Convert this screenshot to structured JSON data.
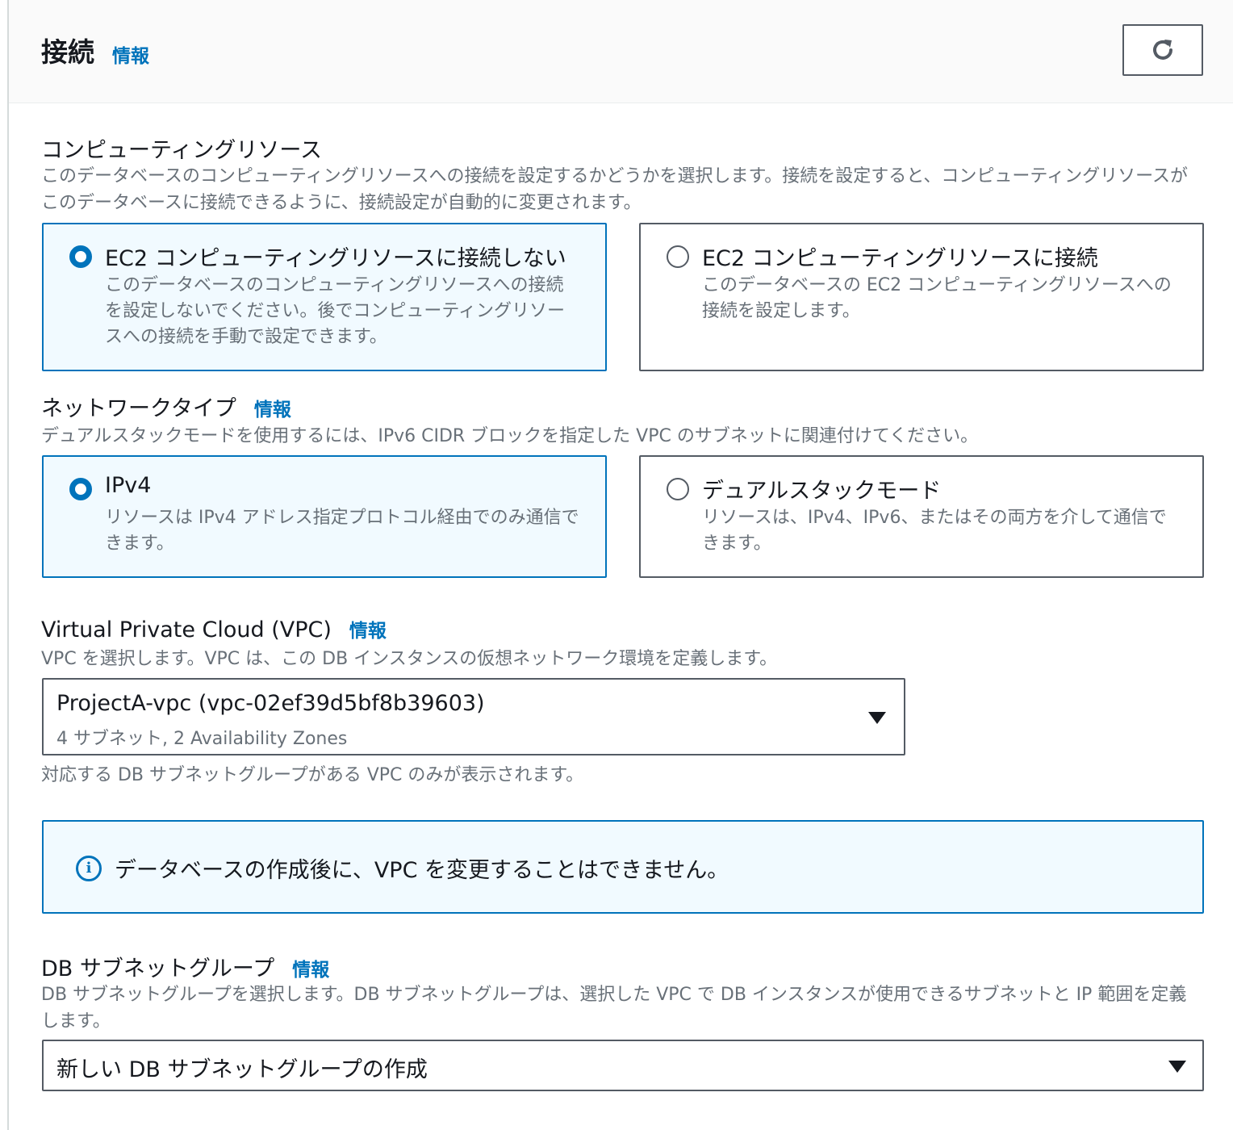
{
  "header": {
    "title": "接続",
    "info": "情報",
    "refresh_icon": "refresh-icon"
  },
  "compute": {
    "label": "コンピューティングリソース",
    "description": "このデータベースのコンピューティングリソースへの接続を設定するかどうかを選択します。接続を設定すると、コンピューティングリソースがこのデータベースに接続できるように、接続設定が自動的に変更されます。",
    "options": [
      {
        "title": "EC2 コンピューティングリソースに接続しない",
        "description": "このデータベースのコンピューティングリソースへの接続を設定しないでください。後でコンピューティングリソースへの接続を手動で設定できます。",
        "selected": true
      },
      {
        "title": "EC2 コンピューティングリソースに接続",
        "description": "このデータベースの EC2 コンピューティングリソースへの接続を設定します。",
        "selected": false
      }
    ]
  },
  "network": {
    "label": "ネットワークタイプ",
    "info": "情報",
    "description": "デュアルスタックモードを使用するには、IPv6 CIDR ブロックを指定した VPC のサブネットに関連付けてください。",
    "options": [
      {
        "title": "IPv4",
        "description": "リソースは IPv4 アドレス指定プロトコル経由でのみ通信できます。",
        "selected": true
      },
      {
        "title": "デュアルスタックモード",
        "description": "リソースは、IPv4、IPv6、またはその両方を介して通信できます。",
        "selected": false
      }
    ]
  },
  "vpc": {
    "label": "Virtual Private Cloud (VPC)",
    "info": "情報",
    "description": "VPC を選択します。VPC は、この DB インスタンスの仮想ネットワーク環境を定義します。",
    "selected_value": "ProjectA-vpc (vpc-02ef39d5bf8b39603)",
    "selected_sub": "4 サブネット, 2 Availability Zones",
    "hint": "対応する DB サブネットグループがある VPC のみが表示されます。"
  },
  "alert": {
    "text": "データベースの作成後に、VPC を変更することはできません。",
    "icon": "info-icon"
  },
  "subnet": {
    "label": "DB サブネットグループ",
    "info": "情報",
    "description": "DB サブネットグループを選択します。DB サブネットグループは、選択した VPC で DB インスタンスが使用できるサブネットと IP 範囲を定義します。",
    "selected_value": "新しい DB サブネットグループの作成"
  },
  "colors": {
    "accent": "#0073bb",
    "selected_bg": "#f1faff",
    "border": "#545b64",
    "muted_text": "#687078"
  }
}
